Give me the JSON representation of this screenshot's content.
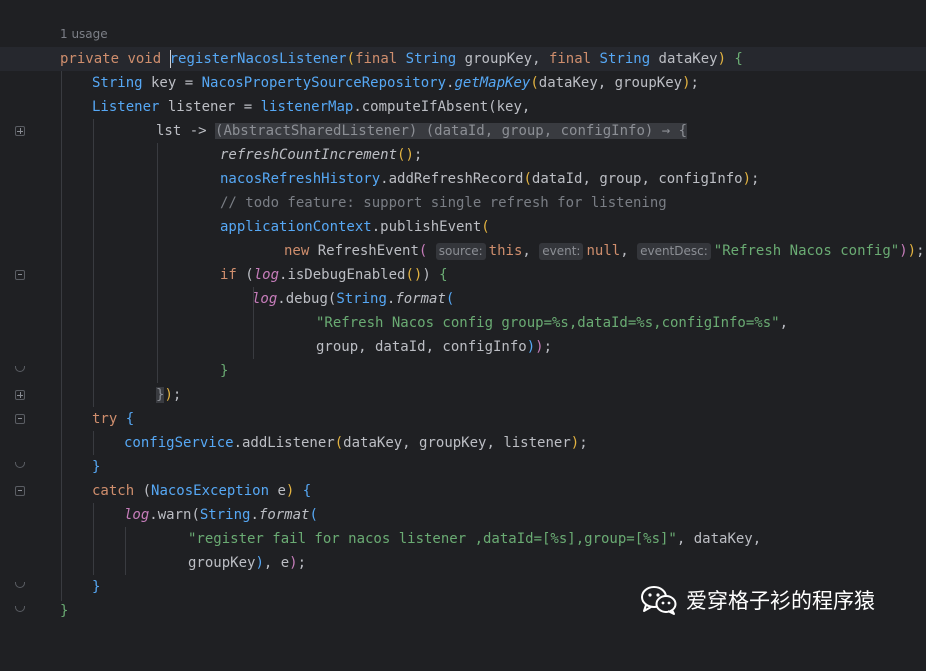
{
  "usage": "1 usage",
  "lines": {
    "l1": {
      "a": "private",
      "b": " ",
      "c": "void",
      "d": " ",
      "e": "registerNacosListener",
      "f": "(",
      "g": "final",
      "h": " ",
      "i": "String",
      "j": " groupKey, ",
      "k": "final",
      "l": " ",
      "m": "String",
      "n": " dataKey",
      "o": ")",
      "p": " {"
    },
    "l2": {
      "a": "String",
      "b": " key = ",
      "c": "NacosPropertySourceRepository",
      "d": ".",
      "e": "getMapKey",
      "f": "(",
      "g": "dataKey, groupKey",
      "h": ")",
      "i": ";"
    },
    "l3": {
      "a": "Listener",
      "b": " listener = ",
      "c": "listenerMap",
      "d": ".computeIfAbsent(key,"
    },
    "l4": {
      "a": "lst -> ",
      "b": "(AbstractSharedListener) (dataId, group, configInfo) → {"
    },
    "l5": {
      "a": "refreshCountIncrement",
      "b": "()",
      "c": ";"
    },
    "l6": {
      "a": "nacosRefreshHistory",
      "b": ".addRefreshRecord",
      "c": "(",
      "d": "dataId, group, configInfo",
      "e": ")",
      "f": ";"
    },
    "l7": {
      "a": "// todo feature: support single refresh for listening"
    },
    "l8": {
      "a": "applicationContext",
      "b": ".publishEvent",
      "c": "("
    },
    "l9": {
      "a": "new",
      "b": " RefreshEvent",
      "c": "(",
      "h1": "source:",
      "d": "this",
      "e": ",",
      "h2": "event:",
      "f": "null",
      "g": ",",
      "h3": "eventDesc:",
      "s": "\"Refresh Nacos config\"",
      "x": ")",
      "y": ")",
      "z": ";"
    },
    "l10": {
      "a": "if",
      "b": " (",
      "c": "log",
      "d": ".isDebugEnabled",
      "e": "()",
      "f": ")",
      "g": " {"
    },
    "l11": {
      "a": "log",
      "b": ".debug(",
      "c": "String",
      "d": ".",
      "e": "format",
      "f": "("
    },
    "l12": {
      "a": "\"Refresh Nacos config group=%s,dataId=%s,configInfo=%s\"",
      "b": ","
    },
    "l13": {
      "a": "group, dataId, configInfo",
      "b": ")",
      "c": ")",
      "d": ";"
    },
    "l14": {
      "a": "}"
    },
    "l15": {
      "a": "}",
      "b": ")",
      "c": ";"
    },
    "l16": {
      "a": "try",
      "b": " {"
    },
    "l17": {
      "a": "configService",
      "b": ".addListener",
      "c": "(",
      "d": "dataKey, groupKey, listener",
      "e": ")",
      "f": ";"
    },
    "l18": {
      "a": "}"
    },
    "l19": {
      "a": "catch",
      "b": " (",
      "c": "NacosException",
      "d": " e",
      "e": ")",
      "f": " {"
    },
    "l20": {
      "a": "log",
      "b": ".warn(",
      "c": "String",
      "d": ".",
      "e": "format",
      "f": "("
    },
    "l21": {
      "a": "\"register fail for nacos listener ,dataId=[%s],group=[%s]\"",
      "b": ", dataKey,"
    },
    "l22": {
      "a": "groupKey",
      "b": ")",
      "c": ", e",
      "d": ")",
      "e": ";"
    },
    "l23": {
      "a": "}"
    },
    "l24": {
      "a": "}"
    }
  },
  "watermark": {
    "text": "爱穿格子衫的程序猿",
    "icon": "wechat-icon"
  }
}
